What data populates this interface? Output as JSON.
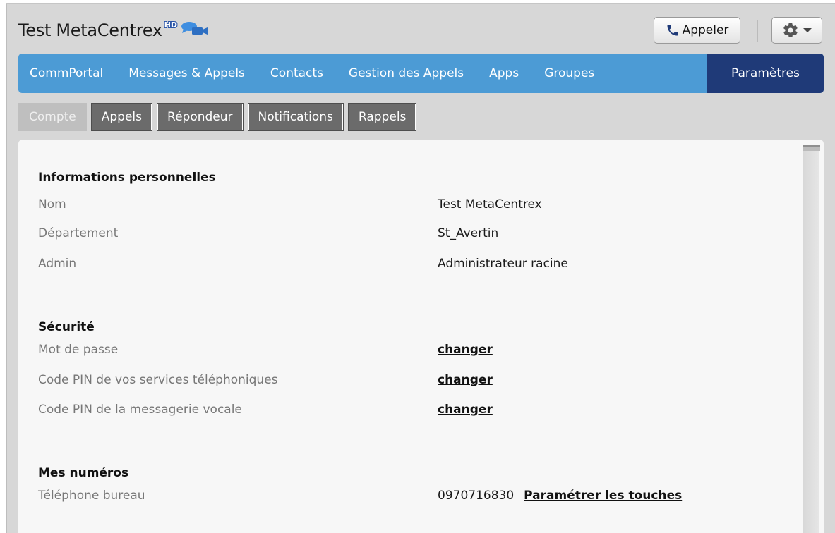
{
  "header": {
    "title": "Test MetaCentrex",
    "hd_badge": "HD",
    "icons": {
      "video": "video-chat-icon",
      "phone": "phone-icon",
      "gear": "gear-icon"
    },
    "call_label": "Appeler"
  },
  "nav": {
    "items": [
      {
        "label": "CommPortal"
      },
      {
        "label": "Messages & Appels"
      },
      {
        "label": "Contacts"
      },
      {
        "label": "Gestion des Appels"
      },
      {
        "label": "Apps"
      },
      {
        "label": "Groupes"
      },
      {
        "label": "Paramètres"
      }
    ],
    "active": "Paramètres",
    "color": "#4c9bd5",
    "active_color": "#1f3a78"
  },
  "subtabs": {
    "items": [
      {
        "label": "Compte"
      },
      {
        "label": "Appels"
      },
      {
        "label": "Répondeur"
      },
      {
        "label": "Notifications"
      },
      {
        "label": "Rappels"
      }
    ],
    "active": "Compte"
  },
  "sections": {
    "personal": {
      "title": "Informations personnelles",
      "rows": [
        {
          "label": "Nom",
          "value": "Test MetaCentrex"
        },
        {
          "label": "Département",
          "value": "St_Avertin"
        },
        {
          "label": "Admin",
          "value": "Administrateur racine"
        }
      ]
    },
    "security": {
      "title": "Sécurité",
      "rows": [
        {
          "label": "Mot de passe",
          "link": "changer"
        },
        {
          "label": "Code PIN de vos services téléphoniques",
          "link": "changer"
        },
        {
          "label": "Code PIN de la messagerie vocale",
          "link": "changer"
        }
      ]
    },
    "numbers": {
      "title": "Mes numéros",
      "rows": [
        {
          "label": "Téléphone bureau",
          "value": "0970716830",
          "link": "Paramétrer les touches"
        }
      ]
    }
  }
}
